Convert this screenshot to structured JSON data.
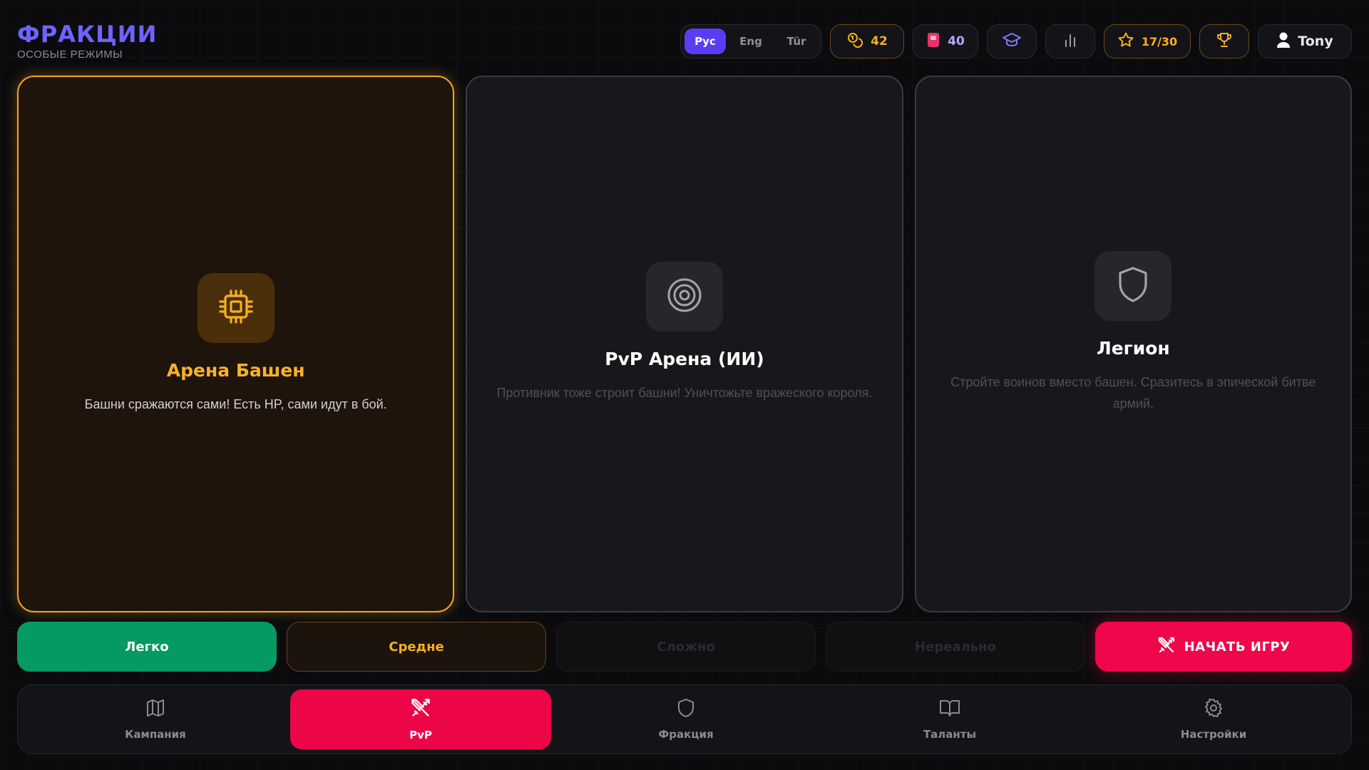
{
  "header": {
    "title": "ФРАКЦИИ",
    "subtitle": "ОСОБЫЕ РЕЖИМЫ"
  },
  "topbar": {
    "languages": [
      "Рус",
      "Eng",
      "Tür"
    ],
    "active_language": "Рус",
    "coins": "42",
    "gems": "40",
    "stars": "17/30",
    "username": "Tony",
    "icons": [
      "coins-icon",
      "gem-icon",
      "graduation-cap-icon",
      "stats-icon",
      "star-icon",
      "trophy-icon",
      "user-icon"
    ]
  },
  "modes": [
    {
      "title": "Арена Башен",
      "desc": "Башни сражаются сами! Есть HP, сами идут в бой.",
      "icon": "chip-icon",
      "selected": true
    },
    {
      "title": "PvP Арена (ИИ)",
      "desc": "Противник тоже строит башни! Уничтожьте вражеского короля.",
      "icon": "target-icon",
      "selected": false
    },
    {
      "title": "Легион",
      "desc": "Стройте воинов вместо башен. Сразитесь в эпической битве армий.",
      "icon": "shield-icon",
      "selected": false
    }
  ],
  "difficulty": {
    "easy": "Легко",
    "medium": "Средне",
    "hard": "Сложно",
    "unreal": "Нереально"
  },
  "start_label": "НАЧАТЬ ИГРУ",
  "nav": [
    {
      "label": "Кампания",
      "icon": "map-icon"
    },
    {
      "label": "PvP",
      "icon": "swords-icon",
      "active": true
    },
    {
      "label": "Фракция",
      "icon": "shield-icon"
    },
    {
      "label": "Таланты",
      "icon": "book-icon"
    },
    {
      "label": "Настройки",
      "icon": "gear-icon"
    }
  ],
  "colors": {
    "accent": "#6f63ff",
    "gold": "#f6b01e",
    "green": "#059a63",
    "red": "#f0064a"
  }
}
